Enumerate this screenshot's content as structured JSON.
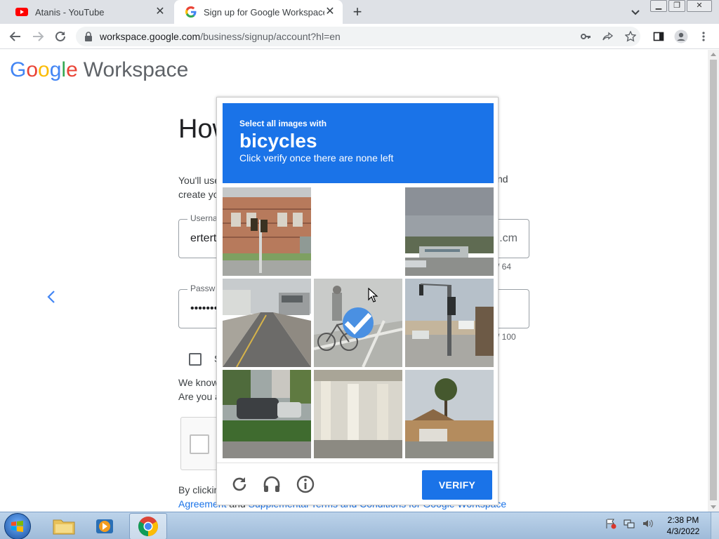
{
  "browser": {
    "tabs": [
      {
        "title": "Atanis - YouTube",
        "icon": "youtube-icon",
        "active": false
      },
      {
        "title": "Sign up for Google Workspace",
        "icon": "google-icon",
        "active": true
      }
    ],
    "url_host": "workspace.google.com",
    "url_path": "/business/signup/account?hl=en",
    "window_buttons": [
      "minimize",
      "restore",
      "close"
    ]
  },
  "page": {
    "logo": {
      "google": "Google",
      "product": "Workspace"
    },
    "heading": "How",
    "paragraph_line1": "You'll use",
    "paragraph_line2": "create yo",
    "paragraph_right": "nd",
    "username_field": {
      "label": "Userna",
      "value": "ertert",
      "suffix": ".cm",
      "counter": "/ 64"
    },
    "password_field": {
      "label": "Passw",
      "value": "•••••••",
      "counter": "/ 100"
    },
    "checkbox_label": "S",
    "know_line1": "We know",
    "know_line2": "Are you a",
    "agree_line1": "By clickin",
    "agree_link1": "Agreement",
    "agree_and": "and",
    "agree_link2": "Supplemental Terms and Conditions for Google Workspace"
  },
  "recaptcha": {
    "instruction_small": "Select all images with",
    "target_object": "bicycles",
    "instruction_hint": "Click verify once there are none left",
    "tiles": [
      {
        "scene": "brick building with traffic light",
        "selected": false
      },
      {
        "scene": "blank (loading)",
        "selected": false
      },
      {
        "scene": "sky over parking lot",
        "selected": false
      },
      {
        "scene": "road with buses",
        "selected": false
      },
      {
        "scene": "cyclist on street",
        "selected": true
      },
      {
        "scene": "intersection with traffic lights",
        "selected": false
      },
      {
        "scene": "parked cars and hedge",
        "selected": false
      },
      {
        "scene": "overpass pillars",
        "selected": false
      },
      {
        "scene": "palm trees and houses",
        "selected": false
      }
    ],
    "verify_label": "VERIFY",
    "footer_icons": [
      "reload-icon",
      "audio-icon",
      "info-icon"
    ]
  },
  "taskbar": {
    "time": "2:38 PM",
    "date": "4/3/2022",
    "apps": [
      "file-explorer",
      "media-player",
      "chrome"
    ]
  },
  "colors": {
    "recaptcha_blue": "#1a73e8",
    "google_blue": "#4285f4",
    "google_red": "#ea4335",
    "google_yellow": "#fbbc05",
    "google_green": "#34a853"
  }
}
